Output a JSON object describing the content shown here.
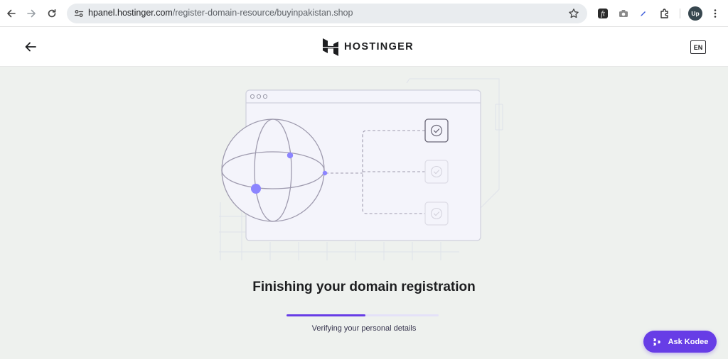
{
  "browser": {
    "url_host": "hpanel.hostinger.com",
    "url_path": "/register-domain-resource/buyinpakistan.shop",
    "profile_initials": "Up"
  },
  "header": {
    "brand": "HOSTINGER",
    "language": "EN"
  },
  "main": {
    "title": "Finishing your domain registration",
    "status": "Verifying your personal details",
    "progress": 0.52
  },
  "assistant": {
    "label": "Ask Kodee"
  },
  "colors": {
    "accent": "#673de6",
    "background": "#eef1ee",
    "text": "#1d1e20"
  }
}
